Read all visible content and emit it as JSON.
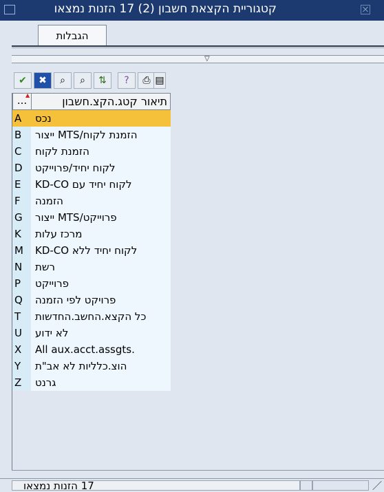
{
  "window": {
    "title": "קטגוריית הקצאת חשבון (2)  17 הזנות נמצאו"
  },
  "tabs": [
    {
      "label": "הגבלות"
    }
  ],
  "separator": {
    "arrow": "▽"
  },
  "toolbar": {
    "icons": [
      "check-icon",
      "cancel-icon",
      "find-icon",
      "find-next-icon",
      "sort-icon",
      "help-icon",
      "print-icon",
      "document-icon"
    ],
    "glyphs": [
      "✔",
      "✖",
      "⌕",
      "⌕",
      "⇅",
      "?",
      "⎙",
      "▤"
    ]
  },
  "table": {
    "column_header": "תיאור קטג.הקצ.חשבון",
    "column_more": "...",
    "rows": [
      {
        "code": "A",
        "desc": "נכס"
      },
      {
        "code": "B",
        "desc": "הזמנת לקוח/MTS ייצור"
      },
      {
        "code": "C",
        "desc": "הזמנת לקוח"
      },
      {
        "code": "D",
        "desc": "לקוח יחיד/פרוייקט"
      },
      {
        "code": "E",
        "desc": "לקוח יחיד עם KD-CO"
      },
      {
        "code": "F",
        "desc": "הזמנה"
      },
      {
        "code": "G",
        "desc": "פרוייקט/MTS ייצור"
      },
      {
        "code": "K",
        "desc": "מרכז עלות"
      },
      {
        "code": "M",
        "desc": "לקוח יחיד ללא KD-CO"
      },
      {
        "code": "N",
        "desc": "רשת"
      },
      {
        "code": "P",
        "desc": "פרוייקט"
      },
      {
        "code": "Q",
        "desc": "פרויקט לפי הזמנה"
      },
      {
        "code": "T",
        "desc": "כל הקצא.החשב.החדשות"
      },
      {
        "code": "U",
        "desc": "לא ידוע"
      },
      {
        "code": "X",
        "desc": "All aux.acct.assgts."
      },
      {
        "code": "Y",
        "desc": "הוצ.כלליות לא אב\"ת"
      },
      {
        "code": "Z",
        "desc": "גרנט"
      }
    ]
  },
  "status": {
    "text": "17 הזנות נמצאו"
  },
  "colors": {
    "titlebar": "#1c3a70",
    "selected_row": "#f5c03a",
    "row_bg": "#eef7fd",
    "code_bg": "#d8ecf8",
    "window_bg": "#dfe6ef"
  }
}
